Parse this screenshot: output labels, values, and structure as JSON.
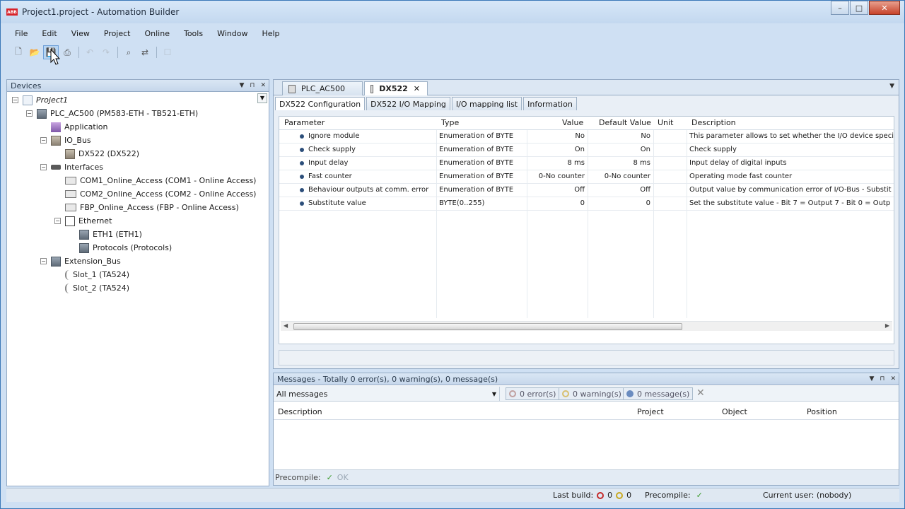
{
  "window": {
    "title": "Project1.project - Automation Builder",
    "logo": "ABB",
    "buttons": [
      "–",
      "□",
      "✕"
    ]
  },
  "menu": [
    "File",
    "Edit",
    "View",
    "Project",
    "Online",
    "Tools",
    "Window",
    "Help"
  ],
  "toolbar": {
    "icons": [
      "new-icon",
      "open-icon",
      "save-icon",
      "print-icon",
      "undo-icon",
      "redo-icon",
      "find-icon",
      "replace-icon",
      "bookmark-icon"
    ]
  },
  "devices": {
    "title": "Devices",
    "tree": [
      {
        "label": "Project1",
        "depth": 0,
        "toggle": "−",
        "icon": "proj",
        "italic": true
      },
      {
        "label": "PLC_AC500 (PM583-ETH - TB521-ETH)",
        "depth": 1,
        "toggle": "−",
        "icon": "plc"
      },
      {
        "label": "Application",
        "depth": 2,
        "toggle": "",
        "icon": "app"
      },
      {
        "label": "IO_Bus",
        "depth": 2,
        "toggle": "−",
        "icon": "bus"
      },
      {
        "label": "DX522 (DX522)",
        "depth": 3,
        "toggle": "",
        "icon": "bus"
      },
      {
        "label": "Interfaces",
        "depth": 2,
        "toggle": "−",
        "icon": "iface"
      },
      {
        "label": "COM1_Online_Access (COM1 - Online Access)",
        "depth": 3,
        "toggle": "",
        "icon": "com"
      },
      {
        "label": "COM2_Online_Access (COM2 - Online Access)",
        "depth": 3,
        "toggle": "",
        "icon": "com"
      },
      {
        "label": "FBP_Online_Access (FBP - Online Access)",
        "depth": 3,
        "toggle": "",
        "icon": "com"
      },
      {
        "label": "Ethernet",
        "depth": 3,
        "toggle": "−",
        "icon": "eth"
      },
      {
        "label": "ETH1 (ETH1)",
        "depth": 4,
        "toggle": "",
        "icon": "plc"
      },
      {
        "label": "Protocols (Protocols)",
        "depth": 4,
        "toggle": "",
        "icon": "plc"
      },
      {
        "label": "Extension_Bus",
        "depth": 2,
        "toggle": "−",
        "icon": "plc"
      },
      {
        "label": "Slot_1 (TA524)",
        "depth": 3,
        "toggle": "",
        "icon": "slot"
      },
      {
        "label": "Slot_2 (TA524)",
        "depth": 3,
        "toggle": "",
        "icon": "slot"
      }
    ]
  },
  "editor": {
    "doc_tabs": [
      {
        "label": "PLC_AC500",
        "active": false
      },
      {
        "label": "DX522",
        "active": true
      }
    ],
    "sub_tabs": [
      "DX522 Configuration",
      "DX522 I/O Mapping",
      "I/O mapping list",
      "Information"
    ],
    "columns": [
      "Parameter",
      "Type",
      "Value",
      "Default Value",
      "Unit",
      "Description"
    ],
    "rows": [
      {
        "param": "Ignore module",
        "type": "Enumeration of BYTE",
        "value": "No",
        "default": "No",
        "unit": "",
        "desc": "This parameter allows to set whether the I/O device speci"
      },
      {
        "param": "Check supply",
        "type": "Enumeration of BYTE",
        "value": "On",
        "default": "On",
        "unit": "",
        "desc": "Check supply"
      },
      {
        "param": "Input delay",
        "type": "Enumeration of BYTE",
        "value": "8 ms",
        "default": "8 ms",
        "unit": "",
        "desc": "Input delay of digital inputs"
      },
      {
        "param": "Fast counter",
        "type": "Enumeration of BYTE",
        "value": "0-No counter",
        "default": "0-No counter",
        "unit": "",
        "desc": "Operating mode fast counter"
      },
      {
        "param": "Behaviour outputs at comm. error",
        "type": "Enumeration of BYTE",
        "value": "Off",
        "default": "Off",
        "unit": "",
        "desc": "Output value by communication error of I/O-Bus - Substit"
      },
      {
        "param": "Substitute value",
        "type": "BYTE(0..255)",
        "value": "0",
        "default": "0",
        "unit": "",
        "desc": "Set the substitute value - Bit 7 = Output 7 - Bit 0 = Outp"
      }
    ]
  },
  "messages": {
    "title": "Messages - Totally 0 error(s), 0 warning(s), 0 message(s)",
    "filter": "All messages",
    "errors": "0 error(s)",
    "warnings": "0 warning(s)",
    "messages": "0 message(s)",
    "columns": [
      "Description",
      "Project",
      "Object",
      "Position"
    ],
    "precompile_label": "Precompile:",
    "precompile_status": "OK"
  },
  "statusbar": {
    "last_build": "Last build:",
    "errors": "0",
    "warnings": "0",
    "precompile": "Precompile:",
    "user": "Current user: (nobody)"
  },
  "colors": {
    "accent": "#3b78b8",
    "brand": "#d8232a",
    "ok": "#3a9a2a",
    "error": "#c42a2a",
    "warning": "#c8a820"
  }
}
